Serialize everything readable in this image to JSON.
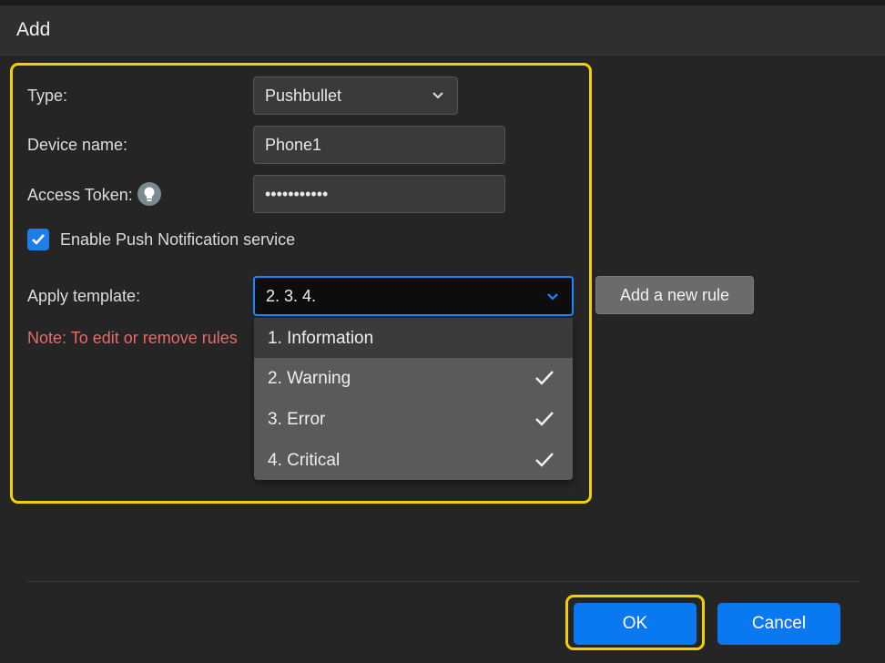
{
  "dialog": {
    "title": "Add"
  },
  "form": {
    "type_label": "Type:",
    "type_value": "Pushbullet",
    "device_label": "Device name:",
    "device_value": "Phone1",
    "token_label": "Access Token:",
    "token_value": "•••••••••••",
    "enable_label": "Enable Push Notification service",
    "enable_checked": true,
    "template_label": "Apply template:",
    "template_value": "2. 3. 4.",
    "add_rule_label": "Add a new rule",
    "note": "Note: To edit or remove rules"
  },
  "dropdown": {
    "options": [
      {
        "label": "1. Information",
        "checked": false
      },
      {
        "label": "2. Warning",
        "checked": true
      },
      {
        "label": "3. Error",
        "checked": true
      },
      {
        "label": "4. Critical",
        "checked": true
      }
    ]
  },
  "footer": {
    "ok_label": "OK",
    "cancel_label": "Cancel"
  },
  "icons": {
    "type_dropdown": "chevron-down-icon",
    "template_dropdown": "chevron-down-icon",
    "token_help": "lightbulb-icon",
    "checkbox": "checkmark-icon",
    "option_check": "checkmark-icon"
  },
  "colors": {
    "accent": "#0a78f0",
    "highlight": "#f5d000",
    "note": "#e86a6a"
  }
}
